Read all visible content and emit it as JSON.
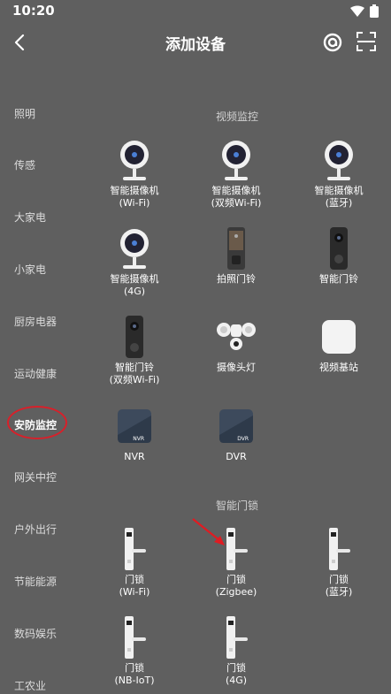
{
  "status": {
    "time": "10:20"
  },
  "header": {
    "title": "添加设备"
  },
  "sidebar": {
    "items": [
      "照明",
      "传感",
      "大家电",
      "小家电",
      "厨房电器",
      "运动健康",
      "安防监控",
      "网关中控",
      "户外出行",
      "节能能源",
      "数码娱乐",
      "工农业"
    ],
    "active_index": 6
  },
  "sections": [
    {
      "title": "视频监控",
      "devices": [
        {
          "l1": "智能摄像机",
          "l2": "(Wi-Fi)",
          "icon": "camera-icon"
        },
        {
          "l1": "智能摄像机",
          "l2": "(双频Wi-Fi)",
          "icon": "camera-icon"
        },
        {
          "l1": "智能摄像机",
          "l2": "(蓝牙)",
          "icon": "camera-icon"
        },
        {
          "l1": "智能摄像机",
          "l2": "(4G)",
          "icon": "camera-icon"
        },
        {
          "l1": "拍照门铃",
          "l2": "",
          "icon": "photo-doorbell-icon"
        },
        {
          "l1": "智能门铃",
          "l2": "",
          "icon": "doorbell-icon"
        },
        {
          "l1": "智能门铃",
          "l2": "(双频Wi-Fi)",
          "icon": "doorbell-icon"
        },
        {
          "l1": "摄像头灯",
          "l2": "",
          "icon": "camera-light-icon"
        },
        {
          "l1": "视频基站",
          "l2": "",
          "icon": "base-station-icon"
        },
        {
          "l1": "NVR",
          "l2": "",
          "icon": "nvr-icon",
          "tag": "NVR"
        },
        {
          "l1": "DVR",
          "l2": "",
          "icon": "dvr-icon",
          "tag": "DVR"
        }
      ]
    },
    {
      "title": "智能门锁",
      "devices": [
        {
          "l1": "门锁",
          "l2": "(Wi-Fi)",
          "icon": "door-lock-icon"
        },
        {
          "l1": "门锁",
          "l2": "(Zigbee)",
          "icon": "door-lock-icon"
        },
        {
          "l1": "门锁",
          "l2": "(蓝牙)",
          "icon": "door-lock-icon"
        },
        {
          "l1": "门锁",
          "l2": "(NB-IoT)",
          "icon": "door-lock-icon"
        },
        {
          "l1": "门锁",
          "l2": "(4G)",
          "icon": "door-lock-icon"
        }
      ]
    }
  ]
}
